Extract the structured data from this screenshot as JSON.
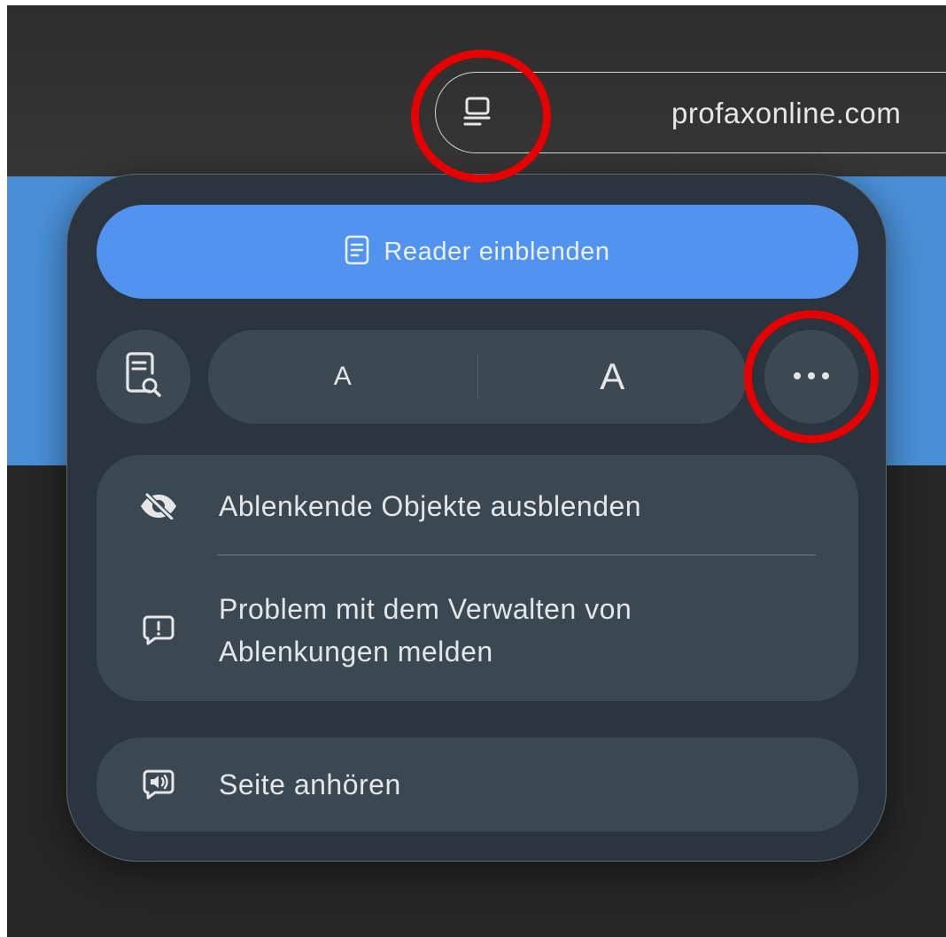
{
  "toolbar": {
    "url": "profaxonline.com",
    "reader_icon": "reader-mode-icon"
  },
  "popover": {
    "reader_button_label": "Reader einblenden",
    "reader_button_icon": "document-icon",
    "search_icon": "document-search-icon",
    "font_small_label": "A",
    "font_large_label": "A",
    "more_icon": "ellipsis-icon",
    "menu_items": [
      {
        "label": "Ablenkende Objekte ausblenden",
        "icon": "eye-slash-icon"
      },
      {
        "label_line1": "Problem mit dem Verwalten von",
        "label_line2": "Ablenkungen melden",
        "icon": "report-bubble-icon"
      }
    ],
    "listen_label": "Seite anhören",
    "listen_icon": "speaker-bubble-icon"
  },
  "colors": {
    "accent_blue": "#5193ee",
    "highlight_red": "#e60000",
    "popover_bg": "#2a3540"
  }
}
